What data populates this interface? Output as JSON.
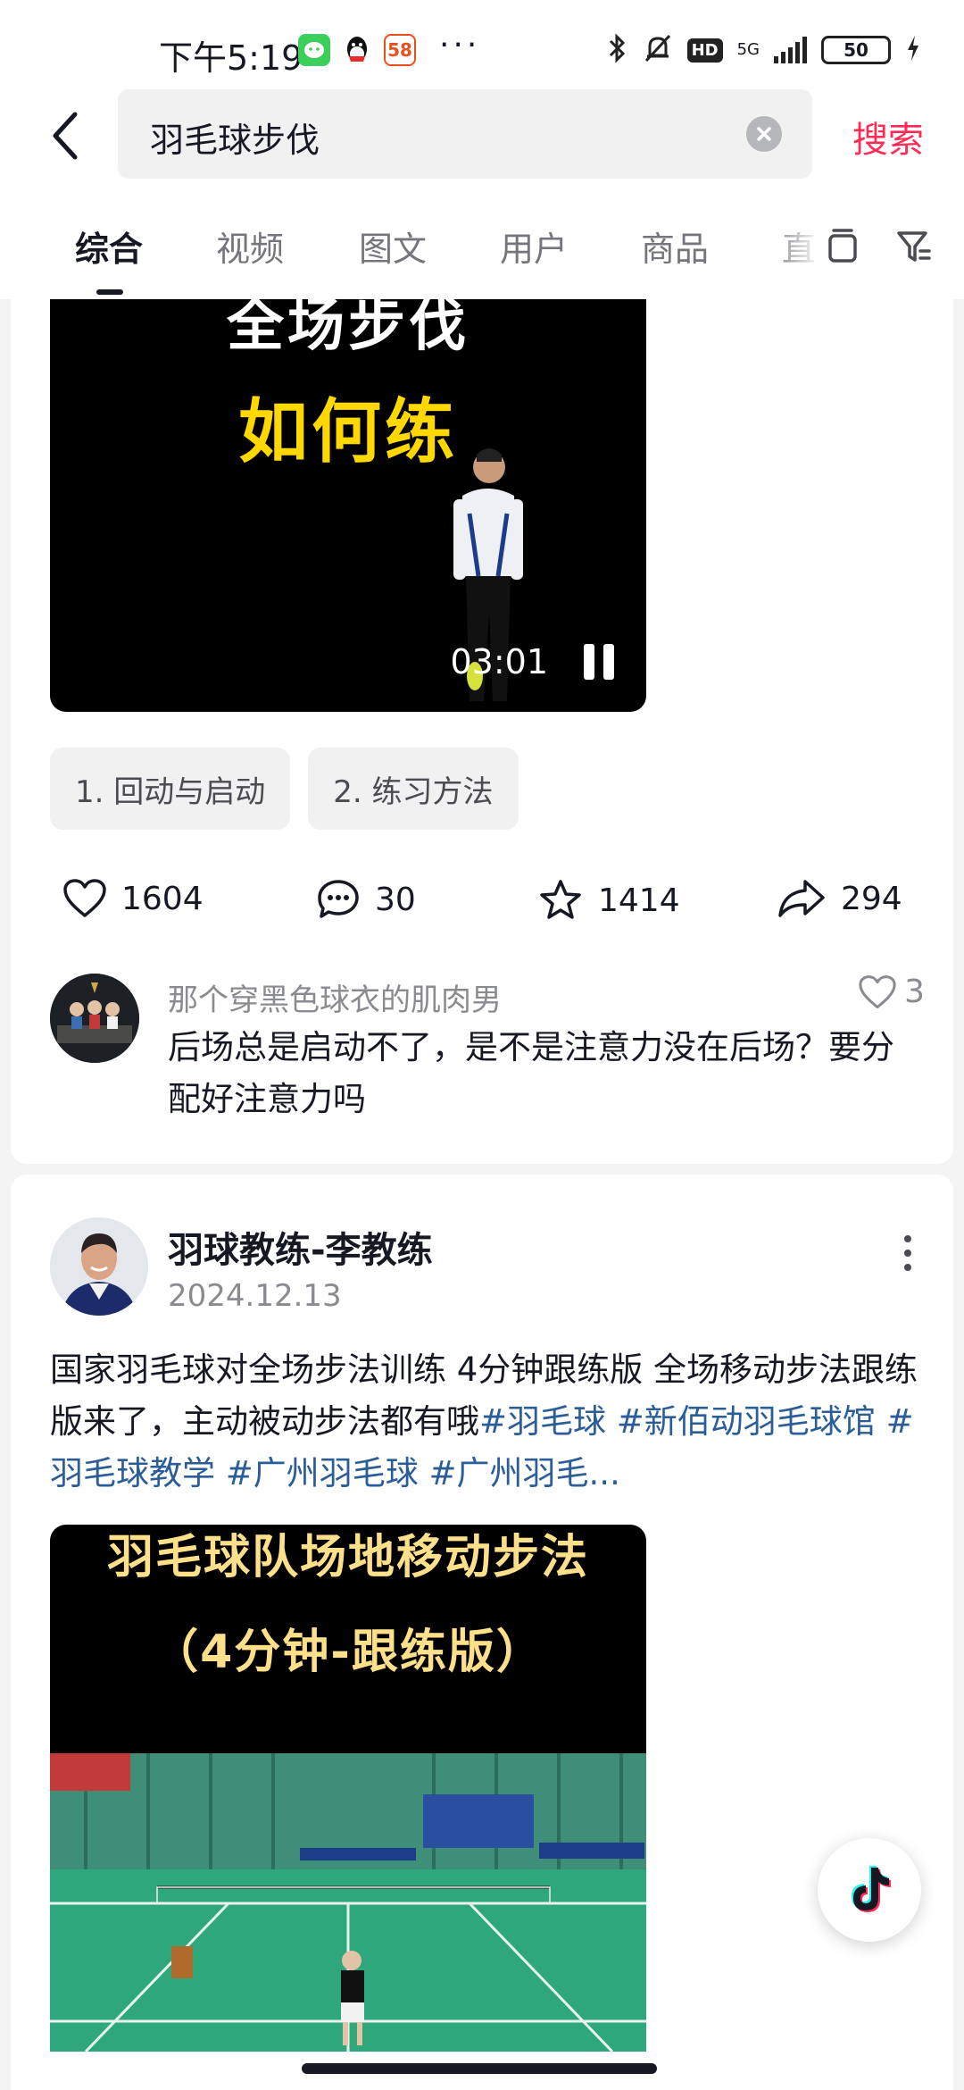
{
  "status_bar": {
    "time": "下午5:19",
    "app_badge_2": "58",
    "more_dots": "···",
    "hd": "HD",
    "network": "5G",
    "battery": "50"
  },
  "search": {
    "query": "羽毛球步伐",
    "submit_label": "搜索"
  },
  "tabs": [
    {
      "label": "综合",
      "active": true
    },
    {
      "label": "视频",
      "active": false
    },
    {
      "label": "图文",
      "active": false
    },
    {
      "label": "用户",
      "active": false
    },
    {
      "label": "商品",
      "active": false
    },
    {
      "label": "直",
      "active": false
    }
  ],
  "post1": {
    "video_title_line1": "全场步伐",
    "video_title_line2": "如何练",
    "duration": "03:01",
    "chapters": [
      "1. 回动与启动",
      "2. 练习方法"
    ],
    "stats": {
      "likes": "1604",
      "comments": "30",
      "favorites": "1414",
      "shares": "294"
    },
    "top_comment": {
      "user": "那个穿黑色球衣的肌肉男",
      "likes": "3",
      "text": "后场总是启动不了，是不是注意力没在后场？要分配好注意力吗"
    }
  },
  "post2": {
    "author": "羽球教练-李教练",
    "date": "2024.12.13",
    "desc_text": "国家羽毛球对全场步法训练 4分钟跟练版 全场移动步法跟练版来了，主动被动步法都有哦",
    "tags": [
      "#羽毛球",
      "#新佰动羽毛球馆",
      "#羽毛球教学",
      "#广州羽毛球",
      "#广州羽毛..."
    ],
    "video_title_line1": "羽毛球队场地移动步法",
    "video_title_line2": "（4分钟-跟练版）"
  },
  "colors": {
    "accent": "#fe2c55",
    "tag": "#2b5d99",
    "video_yellow": "#ffd800"
  }
}
